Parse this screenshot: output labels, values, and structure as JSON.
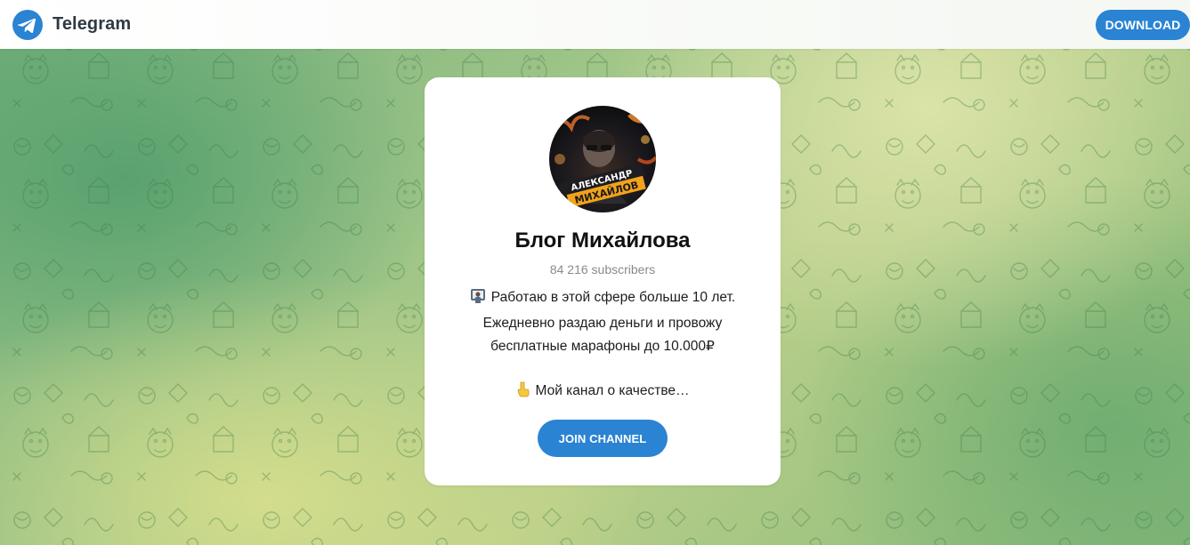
{
  "header": {
    "app_name": "Telegram",
    "download_label": "DOWNLOAD",
    "logo_icon": "telegram-logo-icon"
  },
  "channel": {
    "avatar_text_line1": "АЛЕКСАНДР",
    "avatar_text_line2": "МИХАЙЛОВ",
    "title": "Блог Михайлова",
    "subscribers": "84 216 subscribers",
    "description_lines": [
      "Работаю в этой сфере больше 10 лет.",
      "Ежедневно раздаю деньги и провожу",
      "бесплатные марафоны до 10.000₽"
    ],
    "teaser": "Мой канал о качестве…",
    "join_label": "JOIN CHANNEL"
  },
  "colors": {
    "accent": "#2a83d3",
    "title": "#111111",
    "muted": "#8a8a8a"
  }
}
